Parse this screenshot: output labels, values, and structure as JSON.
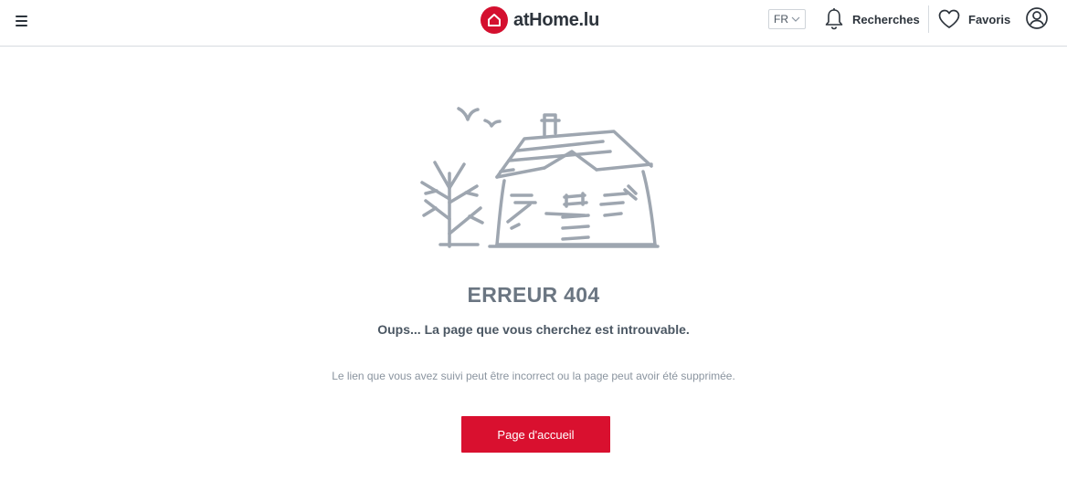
{
  "header": {
    "logo_text": "atHome.lu",
    "language": "FR",
    "searches_label": "Recherches",
    "favorites_label": "Favoris"
  },
  "icons": {
    "menu": "hamburger-menu-icon",
    "logo": "house-logo-icon",
    "language_chevron": "chevron-down-icon",
    "searches": "bell-icon",
    "favorites": "heart-icon",
    "account": "user-circle-icon"
  },
  "error": {
    "title": "ERREUR 404",
    "subtitle": "Oups... La page que vous cherchez est introuvable.",
    "description": "Le lien que vous avez suivi peut être incorrect ou la page peut avoir été supprimée.",
    "button_label": "Page d'accueil"
  },
  "colors": {
    "brand_red": "#d9102f",
    "illustration_gray": "#9ea6b0",
    "title_gray": "#6b7682"
  }
}
